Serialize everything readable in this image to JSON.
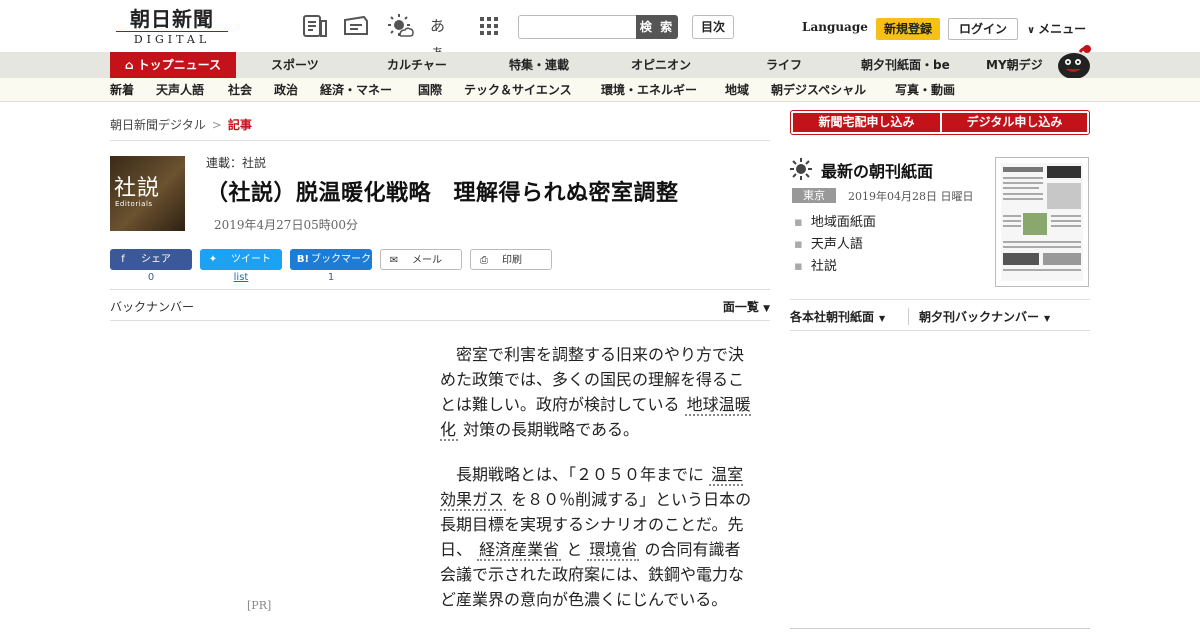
{
  "header": {
    "logo_jp": "朝日新聞",
    "logo_en": "DIGITAL",
    "icons": [
      "news-list-icon",
      "coupon-icon",
      "weather-icon",
      "font-size-icon",
      "grid-menu-icon"
    ],
    "font_icon_text": "あぁ",
    "search_placeholder": "",
    "search_label": "検 索",
    "toc_label": "目次",
    "language_label": "Language",
    "signup_label": "新規登録",
    "login_label": "ログイン",
    "menu_label": "メニュー"
  },
  "mainnav": {
    "items": [
      "トップニュース",
      "スポーツ",
      "カルチャー",
      "特集・連載",
      "オピニオン",
      "ライフ",
      "朝夕刊紙面・be",
      "MY朝デジ"
    ]
  },
  "subnav": {
    "items": [
      "新着",
      "天声人語",
      "社会",
      "政治",
      "経済・マネー",
      "国際",
      "テック＆サイエンス",
      "環境・エネルギー",
      "地域",
      "朝デジスペシャル",
      "写真・動画"
    ]
  },
  "breadcrumb": {
    "home": "朝日新聞デジタル",
    "sep": ">",
    "current": "記事"
  },
  "article": {
    "series_img_big": "社説",
    "series_img_small": "Editorials",
    "series": "連載：社説",
    "title": "（社説）脱温暖化戦略　理解得られぬ密室調整",
    "date": "2019年4月27日05時00分",
    "share": {
      "facebook": "シェア",
      "facebook_count": "0",
      "twitter": "ツイート",
      "twitter_count": "list",
      "hatena": "ブックマーク",
      "hatena_count": "1",
      "mail": "メール",
      "print": "印刷"
    },
    "backnumber": "バックナンバー",
    "index": "面一覧",
    "pr": "[PR]",
    "p1_a": "密室で利害を調整する旧来のやり方で決めた政策では、多くの国民の理解を得ることは難しい。政府が検討している",
    "p1_kw": "地球温暖化",
    "p1_b": "対策の長期戦略である。",
    "p2_a": "長期戦略とは、「２０５０年までに",
    "p2_kw1": "温室効果ガス",
    "p2_b": "を８０％削減する」という日本の長期目標を実現するシナリオのことだ。先日、",
    "p2_kw2": "経済産業省",
    "p2_c": "と",
    "p2_kw3": "環境省",
    "p2_d": "の合同有識者会議で示された政府案には、鉄鋼や電力など産業界の意向が色濃くにじんでいる。"
  },
  "sidebar": {
    "subscribe_paper": "新聞宅配申し込み",
    "subscribe_digital": "デジタル申し込み",
    "today_title": "最新の朝刊紙面",
    "region_tag": "東京",
    "paper_date": "2019年04月28日 日曜日",
    "links": [
      "地域面紙面",
      "天声人語",
      "社説"
    ],
    "bar_left": "各本社朝刊紙面",
    "bar_right": "朝夕刊バックナンバー"
  },
  "colors": {
    "brand_red": "#c4121a",
    "signup_yellow": "#f5c118",
    "facebook": "#3b5998",
    "twitter": "#1da1f2",
    "hatena": "#1d7cd6"
  }
}
